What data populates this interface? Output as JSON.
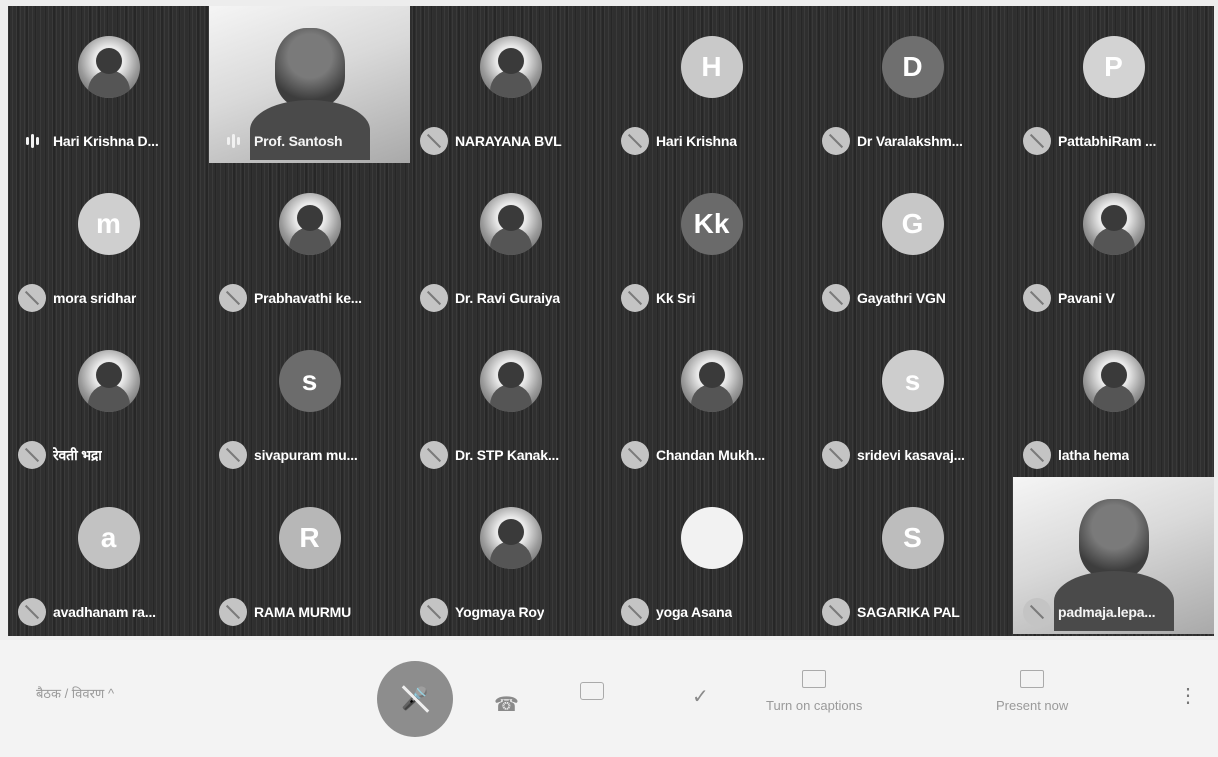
{
  "participants": [
    {
      "name": "Hari Krishna D...",
      "avatar_type": "photo",
      "avatar_letter": "",
      "avatar_color": "",
      "muted": false,
      "speaking": true
    },
    {
      "name": "Prof. Santosh",
      "avatar_type": "video",
      "avatar_letter": "",
      "avatar_color": "",
      "muted": false,
      "speaking": true
    },
    {
      "name": "NARAYANA BVL",
      "avatar_type": "photo",
      "avatar_letter": "",
      "avatar_color": "",
      "muted": true,
      "speaking": false
    },
    {
      "name": "Hari Krishna",
      "avatar_type": "letter",
      "avatar_letter": "H",
      "avatar_color": "#c9c9c9",
      "muted": true,
      "speaking": false
    },
    {
      "name": "Dr Varalakshm...",
      "avatar_type": "letter",
      "avatar_letter": "D",
      "avatar_color": "#6f6f6f",
      "muted": true,
      "speaking": false
    },
    {
      "name": "PattabhiRam ...",
      "avatar_type": "letter",
      "avatar_letter": "P",
      "avatar_color": "#d3d3d3",
      "muted": true,
      "speaking": false
    },
    {
      "name": "mora sridhar",
      "avatar_type": "letter",
      "avatar_letter": "m",
      "avatar_color": "#cfcfcf",
      "muted": true,
      "speaking": false
    },
    {
      "name": "Prabhavathi ke...",
      "avatar_type": "photo",
      "avatar_letter": "",
      "avatar_color": "",
      "muted": true,
      "speaking": false
    },
    {
      "name": "Dr. Ravi Guraiya",
      "avatar_type": "photo",
      "avatar_letter": "",
      "avatar_color": "",
      "muted": true,
      "speaking": false
    },
    {
      "name": "Kk Sri",
      "avatar_type": "letter",
      "avatar_letter": "Kk",
      "avatar_color": "#6a6a6a",
      "muted": true,
      "speaking": false
    },
    {
      "name": "Gayathri VGN",
      "avatar_type": "letter",
      "avatar_letter": "G",
      "avatar_color": "#c7c7c7",
      "muted": true,
      "speaking": false
    },
    {
      "name": "Pavani V",
      "avatar_type": "photo",
      "avatar_letter": "",
      "avatar_color": "",
      "muted": true,
      "speaking": false
    },
    {
      "name": "रेवती भद्रा",
      "avatar_type": "photo",
      "avatar_letter": "",
      "avatar_color": "",
      "muted": true,
      "speaking": false
    },
    {
      "name": "sivapuram mu...",
      "avatar_type": "letter",
      "avatar_letter": "s",
      "avatar_color": "#6c6c6c",
      "muted": true,
      "speaking": false
    },
    {
      "name": "Dr. STP Kanak...",
      "avatar_type": "photo",
      "avatar_letter": "",
      "avatar_color": "",
      "muted": true,
      "speaking": false
    },
    {
      "name": "Chandan Mukh...",
      "avatar_type": "photo",
      "avatar_letter": "",
      "avatar_color": "",
      "muted": true,
      "speaking": false
    },
    {
      "name": "sridevi kasavaj...",
      "avatar_type": "letter",
      "avatar_letter": "s",
      "avatar_color": "#cdcdcd",
      "muted": true,
      "speaking": false
    },
    {
      "name": "latha hema",
      "avatar_type": "photo",
      "avatar_letter": "",
      "avatar_color": "",
      "muted": true,
      "speaking": false
    },
    {
      "name": "avadhanam ra...",
      "avatar_type": "letter",
      "avatar_letter": "a",
      "avatar_color": "#c2c2c2",
      "muted": true,
      "speaking": false
    },
    {
      "name": "RAMA MURMU",
      "avatar_type": "letter",
      "avatar_letter": "R",
      "avatar_color": "#b7b7b7",
      "muted": true,
      "speaking": false
    },
    {
      "name": "Yogmaya Roy",
      "avatar_type": "photo",
      "avatar_letter": "",
      "avatar_color": "",
      "muted": true,
      "speaking": false
    },
    {
      "name": "yoga Asana",
      "avatar_type": "letter",
      "avatar_letter": "",
      "avatar_color": "#f2f2f2",
      "muted": true,
      "speaking": false
    },
    {
      "name": "SAGARIKA PAL",
      "avatar_type": "letter",
      "avatar_letter": "S",
      "avatar_color": "#bdbdbd",
      "muted": true,
      "speaking": false
    },
    {
      "name": "padmaja.lepa...",
      "avatar_type": "video",
      "avatar_letter": "",
      "avatar_color": "",
      "muted": true,
      "speaking": false
    }
  ],
  "controls": {
    "meeting_code": "बैठक / विवरण ^",
    "end_call_icon": "phone-hangup-icon",
    "camera_icon": "camera-icon",
    "check_icon": "check-icon",
    "captions_label": "Turn on captions",
    "present_label": "Present now",
    "more_icon": "more-vert-icon"
  }
}
